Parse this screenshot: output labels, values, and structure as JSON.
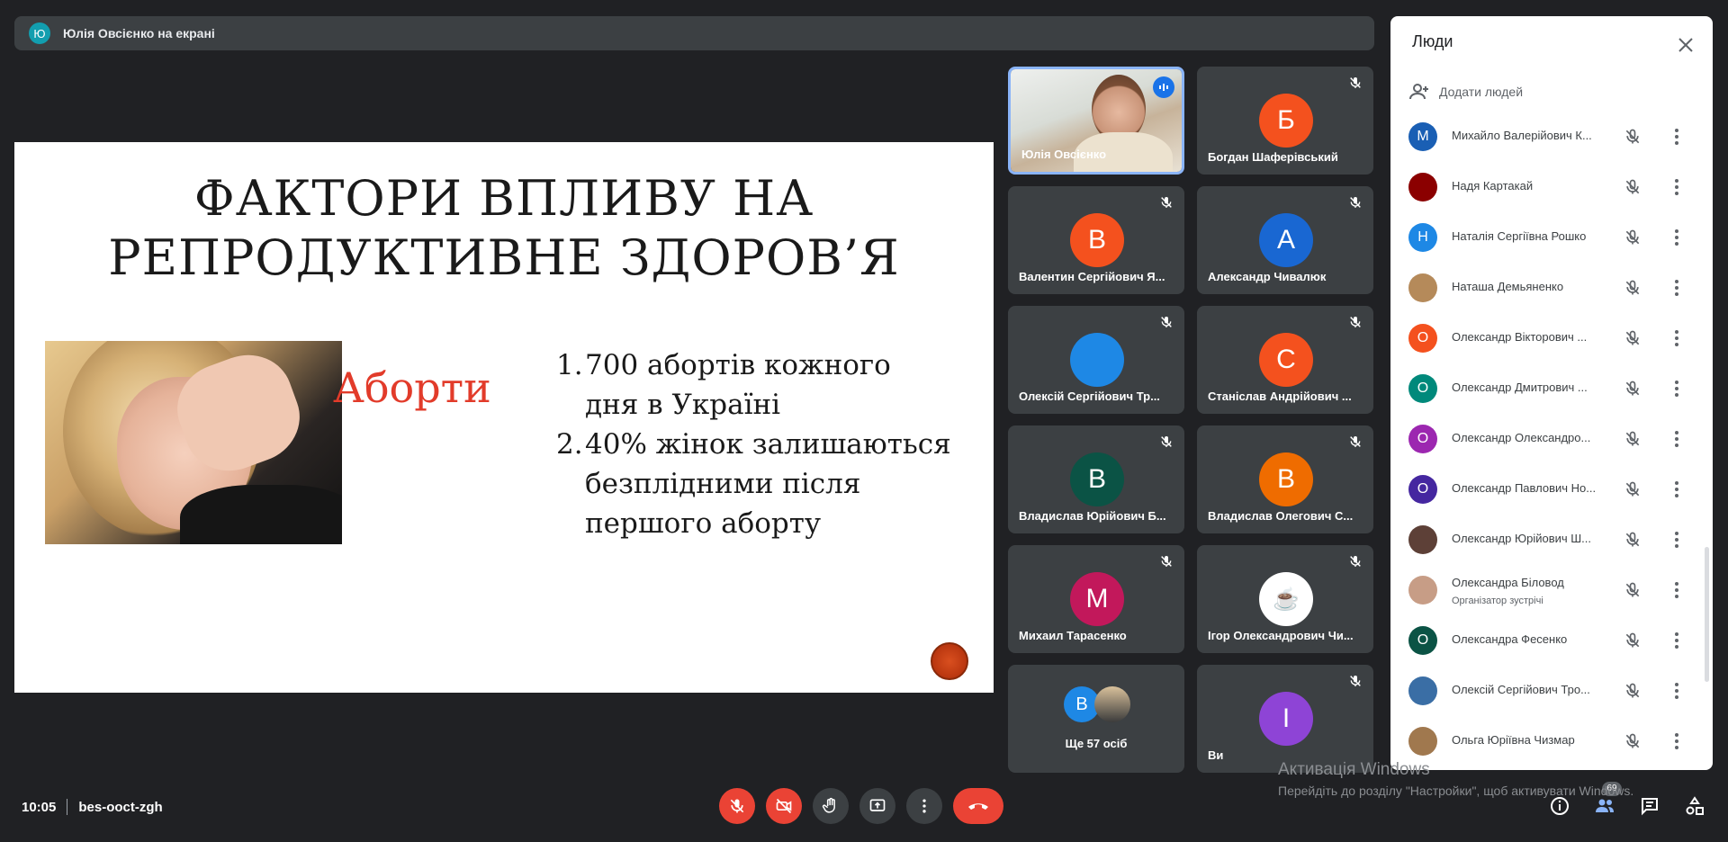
{
  "banner": {
    "avatar": "Ю",
    "text": "Юлія Овсієнко на екрані"
  },
  "slide": {
    "title_line1": "ФАКТОРИ ВПЛИВУ НА",
    "title_line2": "РЕПРОДУКТИВНЕ ЗДОРОВ’Я",
    "red_label": "Аборти",
    "points": [
      {
        "num": "1.",
        "text": "700 абортів кожного дня в Україні"
      },
      {
        "num": "2.",
        "text": "40% жінок залишаються безплідними після першого аборту"
      }
    ]
  },
  "tiles": [
    {
      "name": "Юлія Овсієнко",
      "type": "video"
    },
    {
      "name": "Богдан Шаферівський",
      "initial": "Б",
      "color": "#f4511e"
    },
    {
      "name": "Валентин Сергійович Я...",
      "initial": "В",
      "color": "#f4511e"
    },
    {
      "name": "Александр Чивалюк",
      "initial": "А",
      "color": "#1967d2"
    },
    {
      "name": "Олексій Сергійович Тр...",
      "initial": "",
      "color": "#1e88e5"
    },
    {
      "name": "Станіслав Андрійович ...",
      "initial": "С",
      "color": "#f4511e"
    },
    {
      "name": "Владислав Юрійович Б...",
      "initial": "В",
      "color": "#0b5345"
    },
    {
      "name": "Владислав Олегович С...",
      "initial": "В",
      "color": "#ef6c00"
    },
    {
      "name": "Михаил Тарасенко",
      "initial": "М",
      "color": "#c2185b"
    },
    {
      "name": "Ігор Олександрович Чи...",
      "initial": "☕",
      "color": "#ffffff"
    },
    {
      "name": "Ще 57 осіб",
      "initial": "В",
      "color": "#1e88e5"
    },
    {
      "name": "Ви",
      "initial": "І",
      "color": "#8e44d6"
    }
  ],
  "people": {
    "title": "Люди",
    "add_label": "Додати людей",
    "list": [
      {
        "name": "Михайло Валерійович К...",
        "initial": "М",
        "color": "#1a5fb4"
      },
      {
        "name": "Надя Картакай",
        "initial": "",
        "color": "#8b0000"
      },
      {
        "name": "Наталія Сергіївна Рошко",
        "initial": "Н",
        "color": "#1e88e5"
      },
      {
        "name": "Наташа Демьяненко",
        "initial": "",
        "color": "#b58a5a"
      },
      {
        "name": "Олександр Вікторович ...",
        "initial": "О",
        "color": "#f4511e"
      },
      {
        "name": "Олександр Дмитрович ...",
        "initial": "О",
        "color": "#00897b"
      },
      {
        "name": "Олександр Олександро...",
        "initial": "О",
        "color": "#9c27b0"
      },
      {
        "name": "Олександр Павлович Но...",
        "initial": "О",
        "color": "#4527a0"
      },
      {
        "name": "Олександр Юрійович Ш...",
        "initial": "",
        "color": "#5d4037"
      },
      {
        "name": "Олександра Біловод",
        "sub": "Організатор зустрічі",
        "initial": "",
        "color": "#c79d86"
      },
      {
        "name": "Олександра Фесенко",
        "initial": "О",
        "color": "#0b5345"
      },
      {
        "name": "Олексій Сергійович Тро...",
        "initial": "",
        "color": "#3a6ea5"
      },
      {
        "name": "Ольга Юріївна Чизмар",
        "initial": "",
        "color": "#a0784e"
      }
    ]
  },
  "bottom": {
    "time": "10:05",
    "code": "bes-ooct-zgh",
    "people_count": "69"
  },
  "watermark": {
    "line1": "Активація Windows",
    "line2": "Перейдіть до розділу \"Настройки\", щоб активувати Windows."
  }
}
